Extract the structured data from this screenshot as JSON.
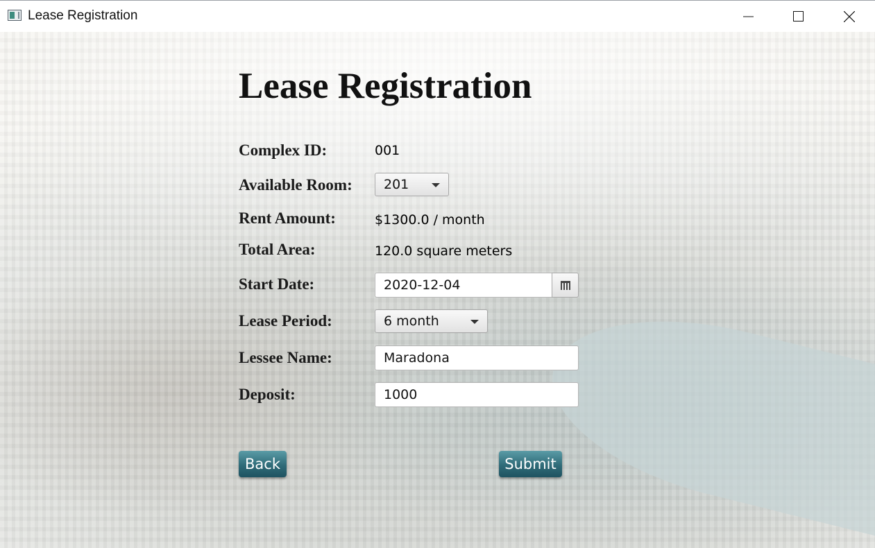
{
  "window": {
    "title": "Lease Registration"
  },
  "page": {
    "heading": "Lease Registration"
  },
  "form": {
    "complex_id": {
      "label": "Complex ID:",
      "value": "001"
    },
    "available_room": {
      "label": "Available Room:",
      "selected": "201"
    },
    "rent_amount": {
      "label": "Rent Amount:",
      "value": "$1300.0 / month"
    },
    "total_area": {
      "label": "Total Area:",
      "value": "120.0 square meters"
    },
    "start_date": {
      "label": "Start Date:",
      "value": "2020-12-04"
    },
    "lease_period": {
      "label": "Lease Period:",
      "selected": "6 month"
    },
    "lessee_name": {
      "label": "Lessee Name:",
      "value": "Maradona"
    },
    "deposit": {
      "label": "Deposit:",
      "value": "1000"
    }
  },
  "buttons": {
    "back": "Back",
    "submit": "Submit"
  },
  "icons": {
    "minimize": "minimize-icon",
    "maximize": "maximize-icon",
    "close": "close-icon",
    "calendar": "calendar-icon",
    "app": "app-icon"
  },
  "colors": {
    "button_accent": "#2f6b78"
  }
}
